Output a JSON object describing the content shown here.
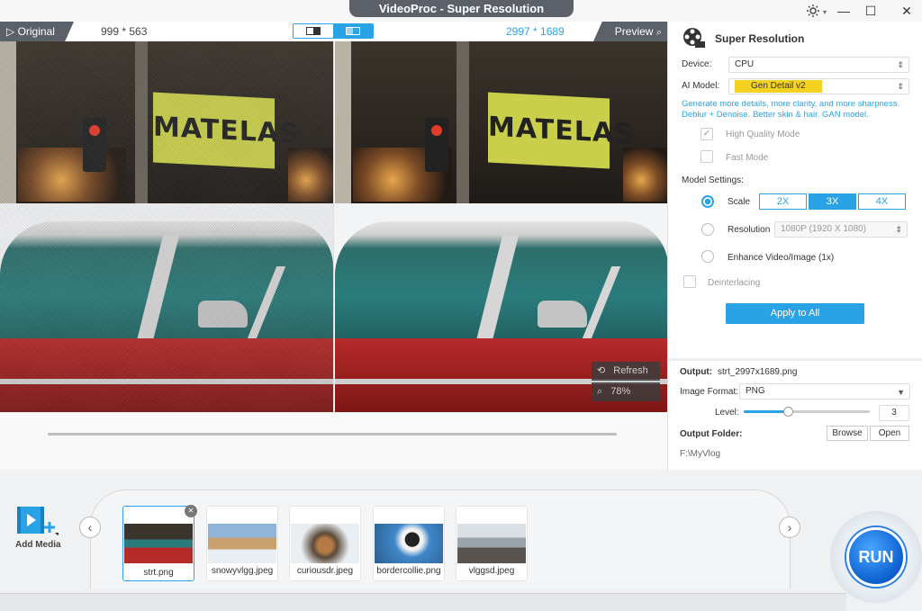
{
  "window": {
    "title": "VideoProc  -  Super Resolution",
    "settings_icon": "gear-icon",
    "minimize": "—",
    "maximize": "☐",
    "close": "✕"
  },
  "preview": {
    "original_label": "▷ Original",
    "original_dimensions": "999 * 563",
    "output_dimensions": "2997 * 1689",
    "preview_label": "Preview",
    "sign_text": "MATELAS",
    "refresh_label": "Refresh",
    "zoom_level": "78%",
    "scrubber_progress": 0
  },
  "panel": {
    "title": "Super Resolution",
    "device_label": "Device:",
    "device_value": "CPU",
    "ai_model_label": "AI Model:",
    "ai_model_value": "Gen Detail v2",
    "model_description": "Generate more details, more clarity, and more sharpness. Deblur + Denoise. Better skin & hair. GAN model.",
    "high_quality_label": "High Quality Mode",
    "high_quality_checked": true,
    "fast_mode_label": "Fast Mode",
    "model_settings_label": "Model Settings:",
    "scale_label": "Scale",
    "scale_options": [
      "2X",
      "3X",
      "4X"
    ],
    "scale_selected": "3X",
    "resolution_label": "Resolution",
    "resolution_value": "1080P (1920 X 1080)",
    "enhance_label": "Enhance Video/Image (1x)",
    "deinterlacing_label": "Deinterlacing",
    "apply_label": "Apply to All",
    "output_label": "Output:",
    "output_file": "strt_2997x1689.png",
    "image_format_label": "Image Format:",
    "image_format_value": "PNG",
    "level_label": "Level:",
    "level_value": "3",
    "level_fraction": 0.35,
    "output_folder_label": "Output Folder:",
    "browse_label": "Browse",
    "open_label": "Open",
    "output_folder_path": "F:\\MyVlog"
  },
  "media": {
    "add_media_label": "Add Media",
    "prev_arrow": "‹",
    "next_arrow": "›",
    "thumbnails": [
      {
        "name": "strt.png",
        "selected": true
      },
      {
        "name": "snowyvlgg.jpeg",
        "selected": false
      },
      {
        "name": "curiousdr.jpeg",
        "selected": false
      },
      {
        "name": "bordercollie.png",
        "selected": false
      },
      {
        "name": "vlggsd.jpeg",
        "selected": false
      }
    ],
    "remove_icon": "✕",
    "run_label": "RUN"
  },
  "colors": {
    "accent": "#2aa3e6",
    "model_badge": "#f5d21f",
    "dark_tab": "#5b6069"
  }
}
